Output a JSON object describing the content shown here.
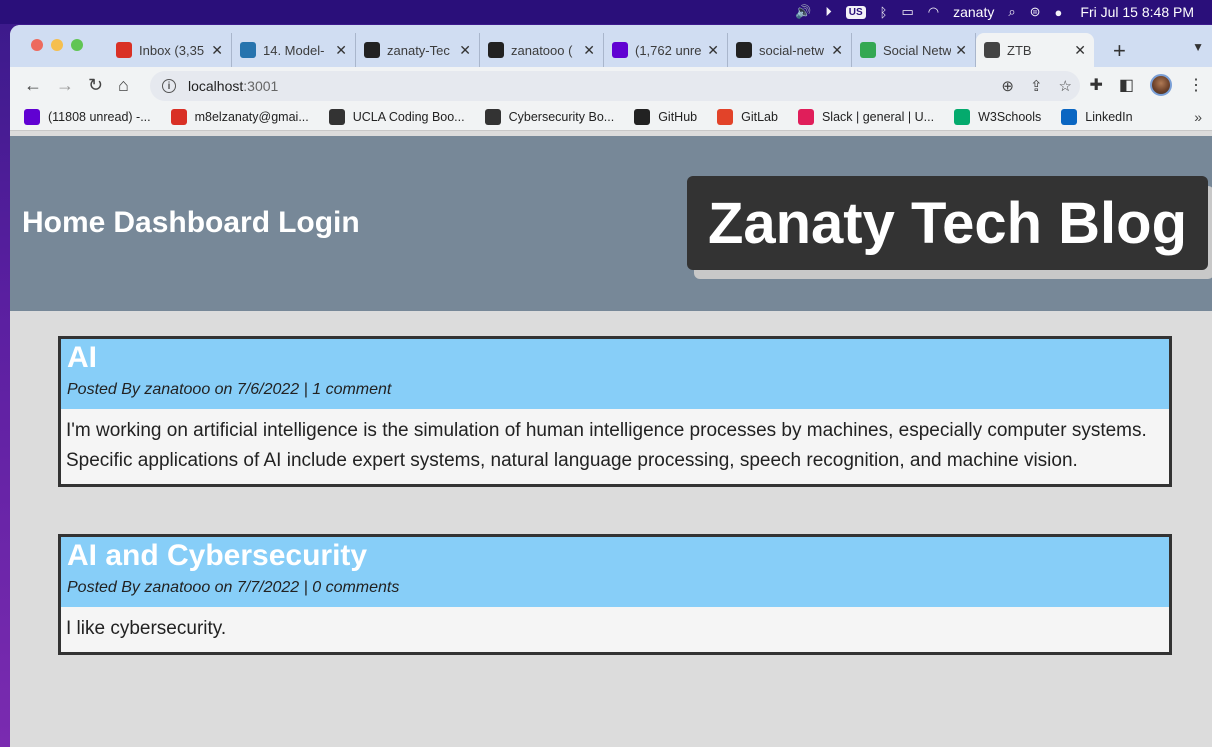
{
  "menubar": {
    "input_source": "US",
    "user": "zanaty",
    "clock": "Fri Jul 15  8:48 PM"
  },
  "tabs": [
    {
      "label": "Inbox (3,35",
      "icon": "gmail-icon",
      "color": "#d93025"
    },
    {
      "label": "14. Model-",
      "icon": "ucla-icon",
      "color": "#2774ae"
    },
    {
      "label": "zanaty-Tec",
      "icon": "github-icon",
      "color": "#222222"
    },
    {
      "label": "zanatooo (",
      "icon": "github-icon",
      "color": "#222222"
    },
    {
      "label": "(1,762 unre",
      "icon": "yahoo-mail-icon",
      "color": "#6001d2"
    },
    {
      "label": "social-netw",
      "icon": "github-icon",
      "color": "#222222"
    },
    {
      "label": "Social Netw",
      "icon": "chrome-icon",
      "color": "#34a853"
    },
    {
      "label": "ZTB",
      "icon": "globe-icon",
      "color": "#444444",
      "active": true
    }
  ],
  "address": {
    "host": "localhost",
    "port": ":3001"
  },
  "bookmarks": [
    {
      "label": "(11808 unread) -...",
      "icon": "yahoo-icon",
      "color": "#6001d2"
    },
    {
      "label": "m8elzanaty@gmai...",
      "icon": "gmail-icon",
      "color": "#d93025"
    },
    {
      "label": "UCLA Coding Boo...",
      "icon": "globe-icon",
      "color": "#333333"
    },
    {
      "label": "Cybersecurity Bo...",
      "icon": "globe-icon",
      "color": "#333333"
    },
    {
      "label": "GitHub",
      "icon": "github-icon",
      "color": "#222222"
    },
    {
      "label": "GitLab",
      "icon": "gitlab-icon",
      "color": "#e24329"
    },
    {
      "label": "Slack | general | U...",
      "icon": "slack-icon",
      "color": "#e01e5a"
    },
    {
      "label": "W3Schools",
      "icon": "w3schools-icon",
      "color": "#04aa6d"
    },
    {
      "label": "LinkedIn",
      "icon": "linkedin-icon",
      "color": "#0a66c2"
    }
  ],
  "site": {
    "nav": [
      "Home",
      "Dashboard",
      "Login"
    ],
    "brand": "Zanaty Tech Blog"
  },
  "posts": [
    {
      "title": "AI",
      "meta": "Posted By zanatooo on 7/6/2022 | 1 comment",
      "body": "I'm working on artificial intelligence is the simulation of human intelligence processes by machines, especially computer systems. Specific applications of AI include expert systems, natural language processing, speech recognition, and machine vision."
    },
    {
      "title": "AI and Cybersecurity",
      "meta": "Posted By zanatooo on 7/7/2022 | 0 comments",
      "body": "I like cybersecurity."
    }
  ]
}
